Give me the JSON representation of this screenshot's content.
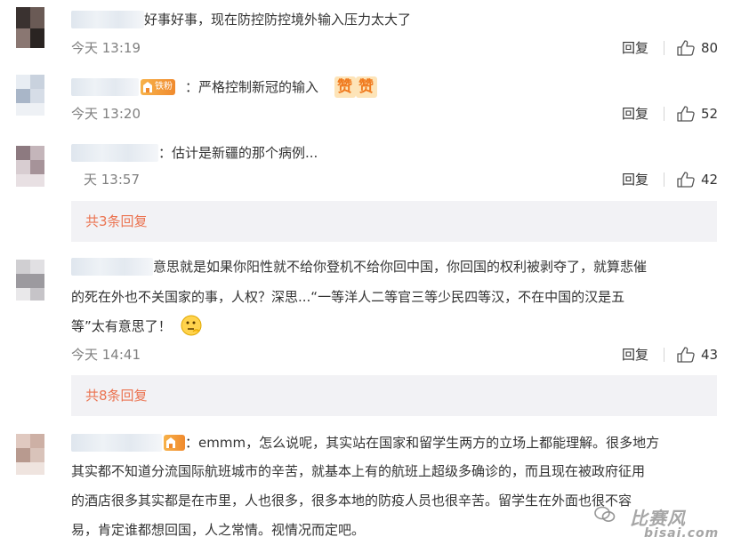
{
  "comments": [
    {
      "text": "好事好事，现在防控防控境外输入压力太大了",
      "time": "今天 13:19",
      "reply_label": "回复",
      "likes": "80"
    },
    {
      "badge": "铁粉",
      "text": "：严格控制新冠的输入",
      "emoticons": [
        "赞",
        "赞"
      ],
      "time": "今天 13:20",
      "reply_label": "回复",
      "likes": "52"
    },
    {
      "text": "：估计是新疆的那个病例...",
      "time": "天 13:57",
      "reply_label": "回复",
      "likes": "42"
    },
    {
      "lines": [
        "意思就是如果你阳性就不给你登机不给你回中国，你回国的权利被剥夺了，就算悲催",
        "的死在外也不关国家的事，人权？深思...“一等洋人二等官三等少民四等汉，不在中国的汉是五",
        "等”太有意思了！"
      ],
      "time": "今天 14:41",
      "reply_label": "回复",
      "likes": "43"
    },
    {
      "lines": [
        "：emmm，怎么说呢，其实站在国家和留学生两方的立场上都能理解。很多地方",
        "其实都不知道分流国际航班城市的辛苦，就基本上有的航班上超级多确诊的，而且现在被政府征用",
        "的酒店很多其实都是在市里，人也很多，很多本地的防疫人员也很辛苦。留学生在外面也很不容",
        "易，肯定谁都想回国，人之常情。视情况而定吧。"
      ]
    }
  ],
  "more_replies": [
    "共3条回复",
    "共8条回复"
  ],
  "watermark": "比赛风",
  "watermark_sub": "bisai.com",
  "colors": {
    "link": "#eb7350",
    "meta": "#808080",
    "text": "#333333",
    "more_bg": "#f2f2f5"
  }
}
